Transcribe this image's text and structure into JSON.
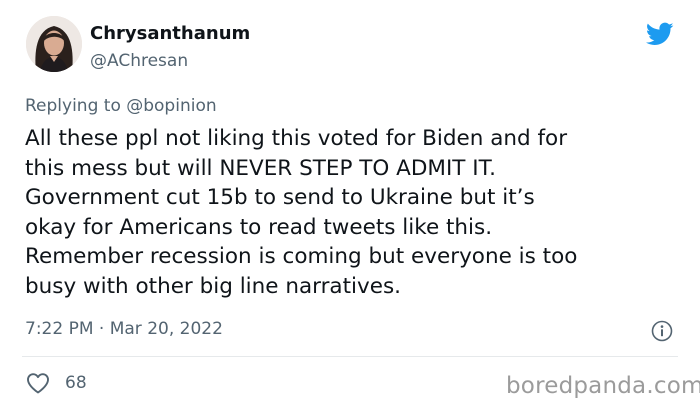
{
  "author": {
    "display_name": "Chrysanthanum",
    "handle": "@AChresan"
  },
  "tweet": {
    "replying_to": "Replying to @bopinion",
    "text": "All these ppl not liking this voted for Biden and for\nthis mess but will NEVER STEP TO ADMIT IT.\nGovernment cut 15b to send to Ukraine but it’s\nokay for Americans to read tweets like this.\nRemember recession is coming but everyone is too\nbusy with other big line narratives.",
    "timestamp": "7:22 PM · Mar 20, 2022",
    "like_count": "68"
  },
  "watermark": "boredpanda.com",
  "colors": {
    "twitter_blue": "#1d9bf0",
    "secondary_text": "#536471",
    "primary_text": "#0f1419"
  },
  "icons": {
    "brand": "twitter-bird-icon",
    "info": "info-icon",
    "like": "heart-icon"
  }
}
